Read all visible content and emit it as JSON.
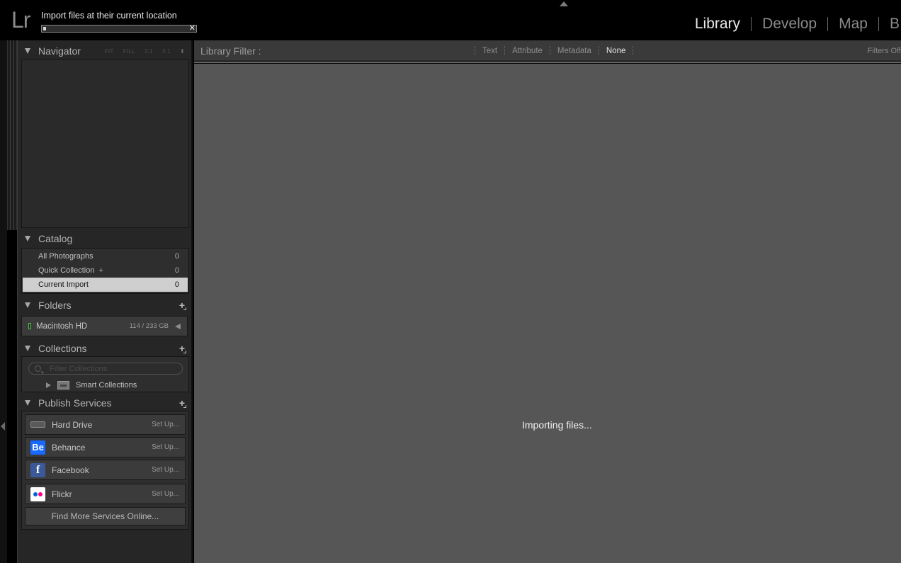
{
  "app": {
    "logo": "Lr"
  },
  "import": {
    "status": "Import files at their current location",
    "progress": 0.02
  },
  "modules": [
    "Library",
    "Develop",
    "Map",
    "B"
  ],
  "active_module": "Library",
  "navigator": {
    "title": "Navigator",
    "zoom_options": [
      "FIT",
      "FILL",
      "1:1",
      "3:1"
    ]
  },
  "catalog": {
    "title": "Catalog",
    "items": [
      {
        "label": "All Photographs",
        "count": "0"
      },
      {
        "label": "Quick Collection",
        "count": "0"
      },
      {
        "label": "Current Import",
        "count": "0"
      }
    ],
    "quick_plus": "+"
  },
  "folders": {
    "title": "Folders",
    "volume": {
      "name": "Macintosh HD",
      "size": "114 / 233 GB"
    }
  },
  "collections": {
    "title": "Collections",
    "filter_placeholder": "Filter Collections",
    "smart_collections": "Smart Collections"
  },
  "publish": {
    "title": "Publish Services",
    "services": [
      {
        "name": "Hard Drive",
        "setup": "Set Up...",
        "icon": "hard-drive-icon"
      },
      {
        "name": "Behance",
        "setup": "Set Up...",
        "icon": "behance-icon",
        "glyph": "Be"
      },
      {
        "name": "Facebook",
        "setup": "Set Up...",
        "icon": "facebook-icon",
        "glyph": "f"
      },
      {
        "name": "Flickr",
        "setup": "Set Up...",
        "icon": "flickr-icon"
      }
    ],
    "find_more": "Find More Services Online..."
  },
  "filter_bar": {
    "label": "Library Filter :",
    "options": [
      "Text",
      "Attribute",
      "Metadata",
      "None"
    ],
    "active_option": "None",
    "right_label": "Filters Off"
  },
  "grid": {
    "message": "Importing files..."
  },
  "colors": {
    "background": "#000000",
    "panel": "#262626",
    "grid": "#565656",
    "behance": "#1769ff",
    "facebook": "#3b5998",
    "flickr_blue": "#0063dc",
    "flickr_pink": "#ff0084",
    "volume_led": "#56b556"
  }
}
